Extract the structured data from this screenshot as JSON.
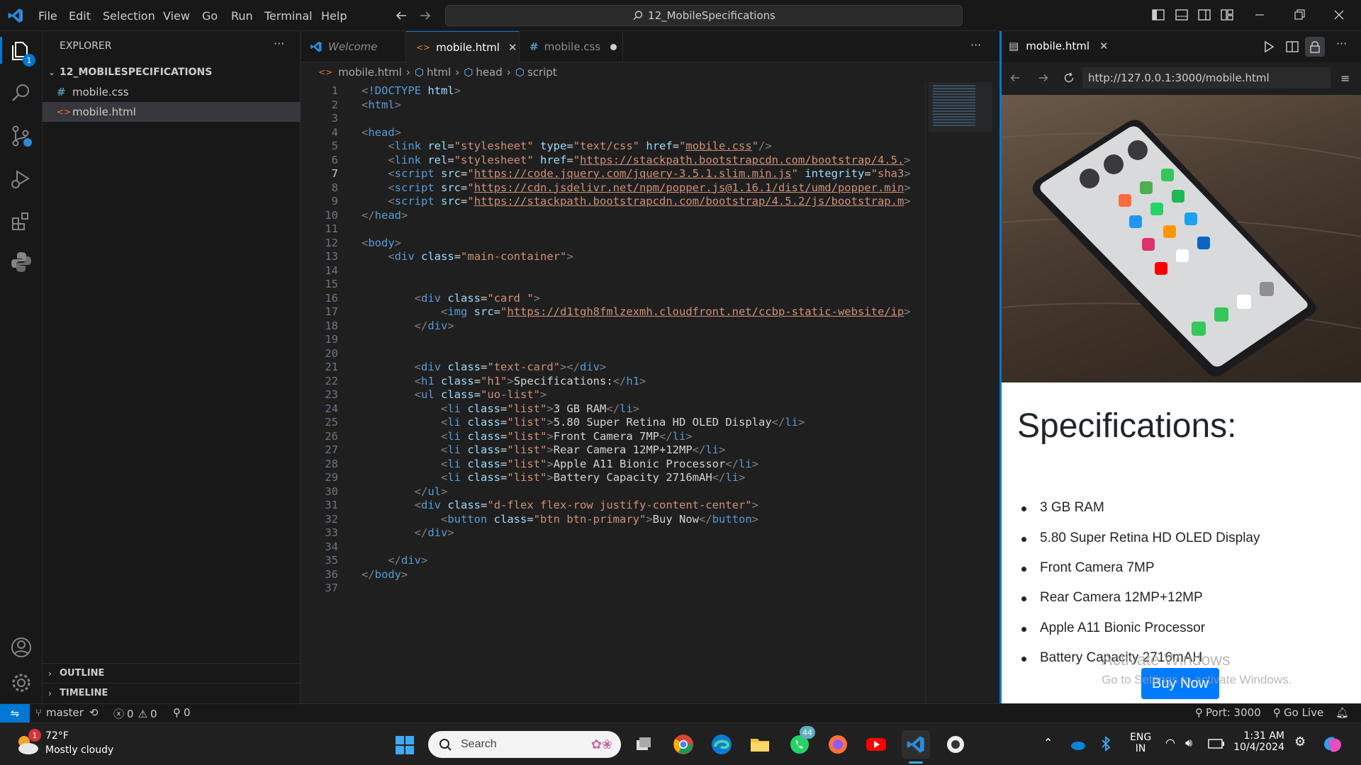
{
  "titlebar": {
    "menu": [
      "File",
      "Edit",
      "Selection",
      "View",
      "Go",
      "Run",
      "Terminal",
      "Help"
    ],
    "command_center": "12_MobileSpecifications"
  },
  "sidebar": {
    "title": "EXPLORER",
    "more": "···",
    "folder": "12_MOBILESPECIFICATIONS",
    "files": [
      {
        "icon": "#",
        "name": "mobile.css"
      },
      {
        "icon": "<>",
        "name": "mobile.html"
      }
    ],
    "outline": "OUTLINE",
    "timeline": "TIMELINE",
    "explorer_badge": "1"
  },
  "tabs": [
    {
      "name": "Welcome"
    },
    {
      "name": "mobile.html"
    },
    {
      "name": "mobile.css"
    }
  ],
  "breadcrumb": [
    "mobile.html",
    "html",
    "head",
    "script"
  ],
  "code_lines": [
    "<!DOCTYPE html>",
    "<html>",
    "",
    "<head>",
    "    <link rel=\"stylesheet\" type=\"text/css\" href=\"mobile.css\"/>",
    "    <link rel=\"stylesheet\" href=\"https://stackpath.bootstrapcdn.com/bootstrap/4.5.",
    "    <script src=\"https://code.jquery.com/jquery-3.5.1.slim.min.js\" integrity=\"sha3",
    "    <script src=\"https://cdn.jsdelivr.net/npm/popper.js@1.16.1/dist/umd/popper.min",
    "    <script src=\"https://stackpath.bootstrapcdn.com/bootstrap/4.5.2/js/bootstrap.m",
    "</head>",
    "",
    "<body>",
    "    <div class=\"main-container\">",
    "",
    "",
    "        <div class=\"card \">",
    "            <img src=\"https://d1tgh8fmlzexmh.cloudfront.net/ccbp-static-website/ip",
    "        </div>",
    "",
    "",
    "        <div class=\"text-card\"></div>",
    "        <h1 class=\"h1\">Specifications:</h1>",
    "        <ul class=\"uo-list\">",
    "            <li class=\"list\">3 GB RAM</li>",
    "            <li class=\"list\">5.80 Super Retina HD OLED Display</li>",
    "            <li class=\"list\">Front Camera 7MP</li>",
    "            <li class=\"list\">Rear Camera 12MP+12MP</li>",
    "            <li class=\"list\">Apple A11 Bionic Processor</li>",
    "            <li class=\"list\">Battery Capacity 2716mAH</li>",
    "        </ul>",
    "        <div class=\"d-flex flex-row justify-content-center\">",
    "            <button class=\"btn btn-primary\">Buy Now</button>",
    "        </div>",
    "",
    "    </div>",
    "</body>",
    ""
  ],
  "preview": {
    "tab": "mobile.html",
    "url": "http://127.0.0.1:3000/mobile.html",
    "heading": "Specifications:",
    "specs": [
      "3 GB RAM",
      "5.80 Super Retina HD OLED Display",
      "Front Camera 7MP",
      "Rear Camera 12MP+12MP",
      "Apple A11 Bionic Processor",
      "Battery Capacity 2716mAH"
    ],
    "button": "Buy Now",
    "watermark_title": "Activate Windows",
    "watermark_sub": "Go to Settings to activate Windows."
  },
  "statusbar": {
    "branch": "master",
    "errors": "0",
    "warnings": "0",
    "ports": "0",
    "port": "Port: 3000",
    "golive": "Go Live"
  },
  "taskbar": {
    "temp": "72°F",
    "weather": "Mostly cloudy",
    "weather_badge": "1",
    "search": "Search",
    "whatsapp_badge": "44",
    "lang1": "ENG",
    "lang2": "IN",
    "time": "1:31 AM",
    "date": "10/4/2024"
  },
  "colors": {
    "accent": "#0078d4",
    "bootstrap_primary": "#007bff",
    "tag": "#569cd6",
    "attr": "#9cdcfe",
    "string": "#ce9178"
  }
}
